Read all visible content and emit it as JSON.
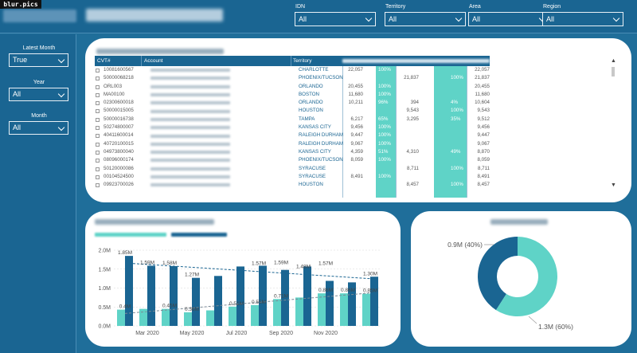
{
  "badge": "blur.pics",
  "slicers_top": [
    {
      "label": "IDN",
      "value": "All"
    },
    {
      "label": "Territory",
      "value": "All"
    },
    {
      "label": "Area",
      "value": "All"
    },
    {
      "label": "Region",
      "value": "All"
    }
  ],
  "slicers_left": [
    {
      "label": "Latest Month",
      "value": "True"
    },
    {
      "label": "Year",
      "value": "All"
    },
    {
      "label": "Month",
      "value": "All"
    }
  ],
  "table": {
    "headers": {
      "cvt": "CVT#",
      "account": "Account",
      "territory": "Territory"
    },
    "rows": [
      {
        "cvt": "10081600567",
        "territory": "CHARLOTTE",
        "n1": "22,057",
        "p1": "100%",
        "n2": "",
        "p2": "",
        "n3": "22,057"
      },
      {
        "cvt": "50000068218",
        "territory": "PHOENIX/TUCSON",
        "n1": "",
        "p1": "",
        "n2": "21,837",
        "p2": "100%",
        "n3": "21,837"
      },
      {
        "cvt": "ORL003",
        "territory": "ORLANDO",
        "n1": "20,455",
        "p1": "100%",
        "n2": "",
        "p2": "",
        "n3": "20,455"
      },
      {
        "cvt": "MA00100",
        "territory": "BOSTON",
        "n1": "11,680",
        "p1": "100%",
        "n2": "",
        "p2": "",
        "n3": "11,680"
      },
      {
        "cvt": "02300600018",
        "territory": "ORLANDO",
        "n1": "10,211",
        "p1": "96%",
        "n2": "394",
        "p2": "4%",
        "n3": "10,604"
      },
      {
        "cvt": "50000015005",
        "territory": "HOUSTON",
        "n1": "",
        "p1": "",
        "n2": "9,543",
        "p2": "100%",
        "n3": "9,543"
      },
      {
        "cvt": "50000016738",
        "territory": "TAMPA",
        "n1": "6,217",
        "p1": "65%",
        "n2": "3,295",
        "p2": "35%",
        "n3": "9,512"
      },
      {
        "cvt": "50274800007",
        "territory": "KANSAS CITY",
        "n1": "9,456",
        "p1": "100%",
        "n2": "",
        "p2": "",
        "n3": "9,456"
      },
      {
        "cvt": "40411600014",
        "territory": "RALEIGH DURHAM",
        "n1": "9,447",
        "p1": "100%",
        "n2": "",
        "p2": "",
        "n3": "9,447"
      },
      {
        "cvt": "40720100015",
        "territory": "RALEIGH DURHAM",
        "n1": "9,067",
        "p1": "100%",
        "n2": "",
        "p2": "",
        "n3": "9,067"
      },
      {
        "cvt": "04973800040",
        "territory": "KANSAS CITY",
        "n1": "4,359",
        "p1": "51%",
        "n2": "4,310",
        "p2": "49%",
        "n3": "8,870"
      },
      {
        "cvt": "08096000174",
        "territory": "PHOENIX/TUCSON",
        "n1": "8,059",
        "p1": "100%",
        "n2": "",
        "p2": "",
        "n3": "8,059"
      },
      {
        "cvt": "50120000086",
        "territory": "SYRACUSE",
        "n1": "",
        "p1": "",
        "n2": "8,711",
        "p2": "100%",
        "n3": "8,711"
      },
      {
        "cvt": "00104524500",
        "territory": "SYRACUSE",
        "n1": "8,491",
        "p1": "100%",
        "n2": "",
        "p2": "",
        "n3": "8,491"
      },
      {
        "cvt": "09923700026",
        "territory": "HOUSTON",
        "n1": "",
        "p1": "",
        "n2": "8,457",
        "p2": "100%",
        "n3": "8,457"
      }
    ]
  },
  "colors": {
    "teal": "#5fd3c7",
    "navy": "#1a6592",
    "background": "#1f6e9a"
  },
  "chart_data": [
    {
      "type": "bar",
      "x": [
        "Feb 2020",
        "Mar 2020",
        "Apr 2020",
        "May 2020",
        "Jun 2020",
        "Jul 2020",
        "Aug 2020",
        "Sep 2020",
        "Oct 2020",
        "Nov 2020",
        "Dec 2020",
        "Jan 2021"
      ],
      "tick_labels": [
        "Mar 2020",
        "May 2020",
        "Jul 2020",
        "Sep 2020",
        "Nov 2020"
      ],
      "yticks": [
        "0.0M",
        "0.5M",
        "1.0M",
        "1.5M",
        "2.0M"
      ],
      "ylim": [
        0,
        2.0
      ],
      "series": [
        {
          "values": [
            0.43,
            0.45,
            0.45,
            0.36,
            0.41,
            0.51,
            0.55,
            0.71,
            0.75,
            0.86,
            0.86,
            0.85
          ]
        },
        {
          "values": [
            1.85,
            1.59,
            1.58,
            1.27,
            1.32,
            1.57,
            1.59,
            1.48,
            1.57,
            1.19,
            1.15,
            1.3
          ]
        }
      ],
      "data_labels": [
        {
          "text": "1.85M",
          "index": 0,
          "value": 1.85
        },
        {
          "text": "1.59M",
          "index": 1,
          "value": 1.59
        },
        {
          "text": "1.58M",
          "index": 2,
          "value": 1.58
        },
        {
          "text": "1.27M",
          "index": 3,
          "value": 1.27
        },
        {
          "text": "1.57M",
          "index": 6,
          "value": 1.57
        },
        {
          "text": "1.59M",
          "index": 7,
          "value": 1.59
        },
        {
          "text": "1.48M",
          "index": 8,
          "value": 1.48
        },
        {
          "text": "1.57M",
          "index": 9,
          "value": 1.57
        },
        {
          "text": "1.30M",
          "index": 11,
          "value": 1.3
        },
        {
          "text": "0.4M",
          "index": 0,
          "value": 0.43
        },
        {
          "text": "0.45M",
          "index": 2,
          "value": 0.45
        },
        {
          "text": "0.36M",
          "index": 3,
          "value": 0.36
        },
        {
          "text": "0.51M",
          "index": 5,
          "value": 0.51
        },
        {
          "text": "0.55M",
          "index": 6,
          "value": 0.55
        },
        {
          "text": "0.71M",
          "index": 7,
          "value": 0.71
        },
        {
          "text": "0.86M",
          "index": 9,
          "value": 0.86
        },
        {
          "text": "0.86M",
          "index": 10,
          "value": 0.86
        },
        {
          "text": "0.85M",
          "index": 11,
          "value": 0.85
        }
      ],
      "trendlines": true,
      "grid": true
    },
    {
      "type": "pie",
      "donut": true,
      "slices": [
        {
          "label": "0.9M (40%)",
          "value": 0.9,
          "color": "#1a6592"
        },
        {
          "label": "1.3M (60%)",
          "value": 1.3,
          "color": "#5fd3c7"
        }
      ]
    }
  ]
}
